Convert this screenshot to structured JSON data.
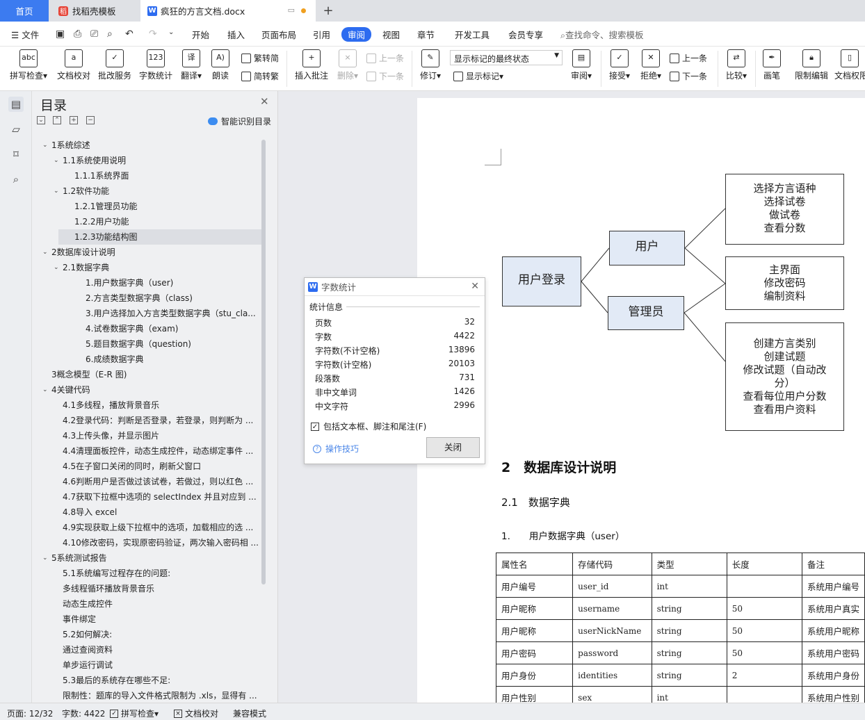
{
  "tabs": {
    "home": "首页",
    "template": "找稻壳模板",
    "doc": "疯狂的方言文档.docx"
  },
  "menu": {
    "file": "文件",
    "items": [
      "开始",
      "插入",
      "页面布局",
      "引用",
      "审阅",
      "视图",
      "章节",
      "开发工具",
      "会员专享"
    ],
    "search": "查找命令、搜索模板"
  },
  "toolbar": {
    "spellcheck": "拼写检查",
    "doccheck": "文档校对",
    "correction": "批改服务",
    "wordcount": "字数统计",
    "translate": "翻译",
    "read": "朗读",
    "trad": "繁转简",
    "simp": "简转繁",
    "insert_comment": "插入批注",
    "delete": "删除",
    "prev_c": "上一条",
    "next_c": "下一条",
    "revise": "修订",
    "mark_state": "显示标记的最终状态",
    "show_marks": "显示标记",
    "review": "审阅",
    "accept": "接受",
    "reject": "拒绝",
    "prev": "上一条",
    "next": "下一条",
    "compare": "比较",
    "pen": "画笔",
    "restrict": "限制编辑",
    "perm": "文档权限"
  },
  "toc": {
    "title": "目录",
    "smart": "智能识别目录",
    "items": [
      {
        "t": "1系统综述",
        "l": 0,
        "c": 1
      },
      {
        "t": "1.1系统使用说明",
        "l": 1,
        "c": 1
      },
      {
        "t": "1.1.1系统界面",
        "l": 2
      },
      {
        "t": "1.2软件功能",
        "l": 1,
        "c": 1
      },
      {
        "t": "1.2.1管理员功能",
        "l": 2
      },
      {
        "t": "1.2.2用户功能",
        "l": 2
      },
      {
        "t": "1.2.3功能结构图",
        "l": 2,
        "sel": 1
      },
      {
        "t": "2数据库设计说明",
        "l": 0,
        "c": 1
      },
      {
        "t": "2.1数据字典",
        "l": 1,
        "c": 1
      },
      {
        "t": "1.用户数据字典（user)",
        "l": 3
      },
      {
        "t": "2.方言类型数据字典（class)",
        "l": 3
      },
      {
        "t": "3.用户选择加入方言类型数据字典（stu_cla...",
        "l": 3
      },
      {
        "t": "4.试卷数据字典（exam)",
        "l": 3
      },
      {
        "t": "5.题目数据字典（question)",
        "l": 3
      },
      {
        "t": "6.成绩数据字典",
        "l": 3
      },
      {
        "t": "3概念模型（E-R 图)",
        "l": 0
      },
      {
        "t": "4关键代码",
        "l": 0,
        "c": 1
      },
      {
        "t": "4.1多线程，播放背景音乐",
        "l": 1
      },
      {
        "t": "4.2登录代码：判断是否登录，若登录，则判断为 ...",
        "l": 1
      },
      {
        "t": "4.3上传头像，并显示图片",
        "l": 1
      },
      {
        "t": "4.4清理面板控件，动态生成控件，动态绑定事件 ...",
        "l": 1
      },
      {
        "t": "4.5在子窗口关闭的同时，刷新父窗口",
        "l": 1
      },
      {
        "t": "4.6判断用户是否做过该试卷，若做过，则以红色 ...",
        "l": 1
      },
      {
        "t": "4.7获取下拉框中选项的 selectIndex 并且对应到 ...",
        "l": 1
      },
      {
        "t": "4.8导入 excel",
        "l": 1
      },
      {
        "t": "4.9实现获取上级下拉框中的选项，加载相应的选 ...",
        "l": 1
      },
      {
        "t": "4.10修改密码，实现原密码验证，两次输入密码相 ...",
        "l": 1
      },
      {
        "t": "5系统测试报告",
        "l": 0,
        "c": 1
      },
      {
        "t": "5.1系统编写过程存在的问题:",
        "l": 1
      },
      {
        "t": "多线程循环播放背景音乐",
        "l": 1
      },
      {
        "t": "动态生成控件",
        "l": 1
      },
      {
        "t": "事件绑定",
        "l": 1
      },
      {
        "t": "5.2如何解决:",
        "l": 1
      },
      {
        "t": "通过查阅资料",
        "l": 1
      },
      {
        "t": "单步运行调试",
        "l": 1
      },
      {
        "t": "5.3最后的系统存在哪些不足:",
        "l": 1
      },
      {
        "t": "限制性：题库的导入文件格式限制为 .xls，显得有 ...",
        "l": 1
      }
    ]
  },
  "flow": {
    "login": "用户登录",
    "user": "用户",
    "admin": "管理员",
    "box1": [
      "选择方言语种",
      "选择试卷",
      "做试卷",
      "查看分数"
    ],
    "box2": [
      "主界面",
      "修改密码",
      "编制资料"
    ],
    "box3": [
      "创建方言类别",
      "创建试题",
      "修改试题（自动改",
      "分）",
      "查看每位用户分数",
      "查看用户资料"
    ]
  },
  "doc": {
    "h1": "2　数据库设计说明",
    "h2": "2.1　数据字典",
    "h3": "1.　　用户数据字典（user）",
    "table": {
      "head": [
        "属性名",
        "存储代码",
        "类型",
        "长度",
        "备注"
      ],
      "rows": [
        [
          "用户编号",
          "user_id",
          "int",
          "",
          "系统用户编号"
        ],
        [
          "用户昵称",
          "username",
          "string",
          "50",
          "系统用户真实"
        ],
        [
          "用户昵称",
          "userNickName",
          "string",
          "50",
          "系统用户昵称"
        ],
        [
          "用户密码",
          "password",
          "string",
          "50",
          "系统用户密码"
        ],
        [
          "用户身份",
          "identities",
          "string",
          "2",
          "系统用户身份"
        ],
        [
          "用户性别",
          "sex",
          "int",
          "",
          "系统用户性别"
        ]
      ]
    }
  },
  "dialog": {
    "title": "字数统计",
    "section": "统计信息",
    "stats": [
      [
        "页数",
        "32"
      ],
      [
        "字数",
        "4422"
      ],
      [
        "字符数(不计空格)",
        "13896"
      ],
      [
        "字符数(计空格)",
        "20103"
      ],
      [
        "段落数",
        "731"
      ],
      [
        "非中文单词",
        "1426"
      ],
      [
        "中文字符",
        "2996"
      ]
    ],
    "include": "包括文本框、脚注和尾注(F)",
    "tips": "操作技巧",
    "close": "关闭"
  },
  "status": {
    "page": "页面: 12/32",
    "words": "字数: 4422",
    "spell": "拼写检查",
    "doccheck": "文档校对",
    "compat": "兼容模式"
  }
}
